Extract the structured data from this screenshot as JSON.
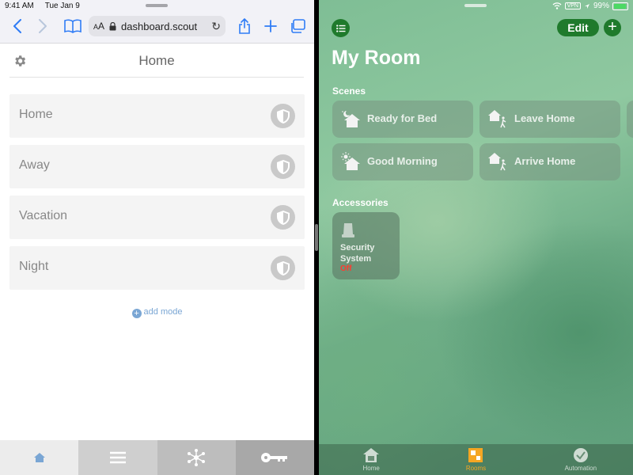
{
  "status": {
    "time": "9:41 AM",
    "date": "Tue Jan 9",
    "vpn": "VPN",
    "battery": "99%"
  },
  "safari": {
    "url_aa_small": "A",
    "url_aa_large": "A",
    "url_text": "dashboard.scout",
    "page_title": "Home",
    "modes": [
      {
        "label": "Home"
      },
      {
        "label": "Away"
      },
      {
        "label": "Vacation"
      },
      {
        "label": "Night"
      }
    ],
    "add_mode_label": "add mode",
    "tabs": [
      "home-icon",
      "menu-icon",
      "hub-icon",
      "key-icon"
    ]
  },
  "home_app": {
    "edit_label": "Edit",
    "room_title": "My Room",
    "scenes_label": "Scenes",
    "scenes": [
      {
        "label": "Ready for Bed",
        "icon": "house-moon-icon"
      },
      {
        "label": "Leave Home",
        "icon": "house-walk-icon"
      },
      {
        "label": "Good Morning",
        "icon": "house-sun-icon"
      },
      {
        "label": "Arrive Home",
        "icon": "house-walk-icon"
      }
    ],
    "accessories_label": "Accessories",
    "accessory": {
      "name": "Security System",
      "state": "Off"
    },
    "tabs": [
      {
        "label": "Home"
      },
      {
        "label": "Rooms"
      },
      {
        "label": "Automation"
      }
    ],
    "colors": {
      "accent_green": "#1f7a2c",
      "active_tab": "#f5a623",
      "off_state": "#ff3b30"
    }
  }
}
